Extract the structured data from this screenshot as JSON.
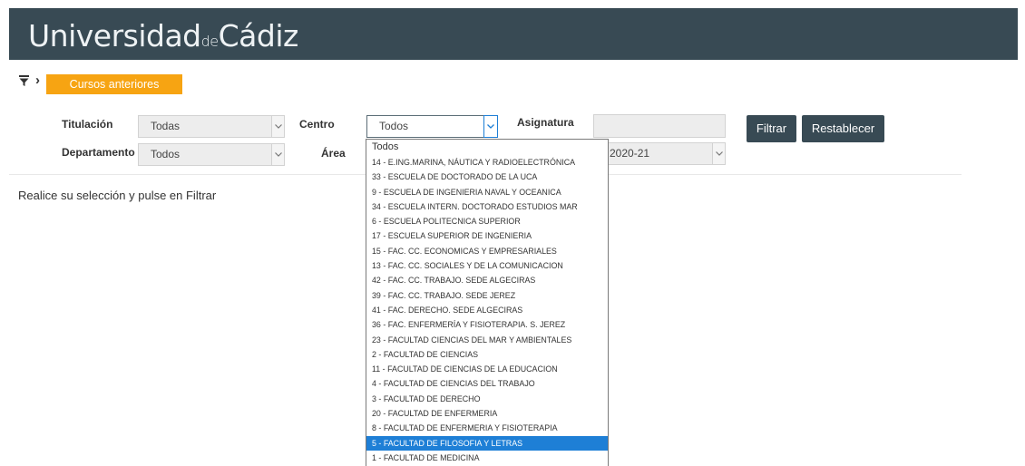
{
  "header": {
    "brand_left": "Universidad",
    "brand_mid": "de",
    "brand_right": "Cádiz"
  },
  "breadcrumb": {
    "filter_icon": "filter-icon",
    "chevron": "›",
    "previous_courses_label": "Cursos anteriores"
  },
  "filters": {
    "titulacion": {
      "label": "Titulación",
      "value": "Todas"
    },
    "centro": {
      "label": "Centro",
      "value": "Todos"
    },
    "asignatura": {
      "label": "Asignatura",
      "value": ""
    },
    "departamento": {
      "label": "Departamento",
      "value": "Todos"
    },
    "area": {
      "label": "Área",
      "value": ""
    },
    "curso": {
      "value": "2020-21"
    }
  },
  "buttons": {
    "filter": "Filtrar",
    "reset": "Restablecer"
  },
  "message": "Realice su selección y pulse en Filtrar",
  "centro_options": [
    "Todos",
    "14 - E.ING.MARINA, NÁUTICA Y RADIOELECTRÓNICA",
    "33 - ESCUELA DE DOCTORADO DE LA UCA",
    "9 - ESCUELA DE INGENIERIA NAVAL Y OCEANICA",
    "34 - ESCUELA INTERN. DOCTORADO ESTUDIOS MAR",
    "6 - ESCUELA POLITECNICA SUPERIOR",
    "17 - ESCUELA SUPERIOR DE INGENIERIA",
    "15 - FAC. CC. ECONOMICAS Y EMPRESARIALES",
    "13 - FAC. CC. SOCIALES Y DE LA COMUNICACION",
    "42 - FAC. CC. TRABAJO. SEDE ALGECIRAS",
    "39 - FAC. CC. TRABAJO. SEDE JEREZ",
    "41 - FAC. DERECHO. SEDE ALGECIRAS",
    "36 - FAC. ENFERMERÍA Y FISIOTERAPIA. S. JEREZ",
    "23 - FACULTAD CIENCIAS DEL MAR Y AMBIENTALES",
    "2 - FACULTAD DE CIENCIAS",
    "11 - FACULTAD DE CIENCIAS DE LA EDUCACION",
    "4 - FACULTAD DE CIENCIAS DEL TRABAJO",
    "3 - FACULTAD DE DERECHO",
    "20 - FACULTAD DE ENFERMERIA",
    "8 - FACULTAD DE ENFERMERIA Y FISIOTERAPIA",
    "5 - FACULTAD DE FILOSOFIA Y LETRAS",
    "1 - FACULTAD DE MEDICINA"
  ],
  "highlighted_option": "5 - FACULTAD DE FILOSOFIA Y LETRAS",
  "colors": {
    "header_bg": "#384a54",
    "accent_orange": "#f7a412",
    "highlight_blue": "#1e7fd6"
  }
}
